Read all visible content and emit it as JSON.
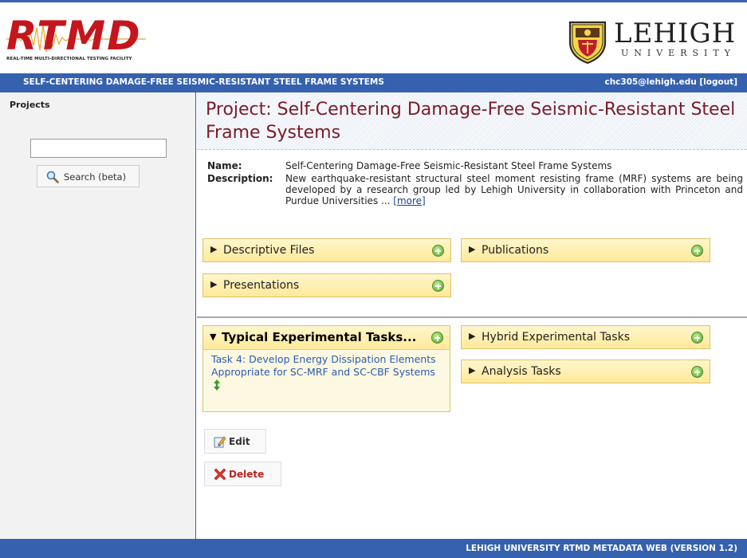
{
  "header": {
    "logo_text": "RTMD",
    "logo_tagline": "REAL-TIME MULTI-DIRECTIONAL TESTING FACILITY",
    "university_name": "LEHIGH",
    "university_sub": "UNIVERSITY"
  },
  "titlebar": {
    "section_title": "SELF-CENTERING DAMAGE-FREE SEISMIC-RESISTANT STEEL FRAME SYSTEMS",
    "user_link": "chc305@lehigh.edu [logout]"
  },
  "sidebar": {
    "projects_label": "Projects",
    "search_value": "",
    "search_button_label": "Search (beta)"
  },
  "project": {
    "title": "Project: Self-Centering Damage-Free Seismic-Resistant Steel Frame Systems",
    "name_label": "Name:",
    "name_value": "Self-Centering Damage-Free Seismic-Resistant Steel Frame Systems",
    "description_label": "Description:",
    "description_value": "New earthquake-resistant structural steel moment resisting frame (MRF) systems are being developed by a research group led by Lehigh University in collaboration with Princeton and Purdue Universities ...",
    "more_link": "[more]"
  },
  "panels": {
    "descriptive_files": "Descriptive Files",
    "publications": "Publications",
    "presentations": "Presentations",
    "typical_tasks": "Typical Experimental Tasks...",
    "hybrid_tasks": "Hybrid Experimental Tasks",
    "analysis_tasks": "Analysis Tasks"
  },
  "tasks": {
    "item_1": "Task 4: Develop Energy Dissipation Elements Appropriate for SC-MRF and SC-CBF Systems"
  },
  "actions": {
    "edit_label": "Edit",
    "delete_label": "Delete"
  },
  "footer": {
    "text": "LEHIGH UNIVERSITY RTMD METADATA WEB (VERSION 1.2)"
  },
  "colors": {
    "bar_blue": "#3561ae",
    "title_maroon": "#7a1c28",
    "panel_yellow": "#ffe99a",
    "link_blue": "#2a5db0",
    "logo_red": "#c4161c"
  },
  "icons": {
    "expand": "plus-circle-icon",
    "collapsed": "triangle-right-icon",
    "expanded": "triangle-down-icon",
    "search": "magnifier-icon",
    "edit": "pencil-icon",
    "delete": "red-x-icon",
    "reorder": "up-down-arrow-icon"
  }
}
